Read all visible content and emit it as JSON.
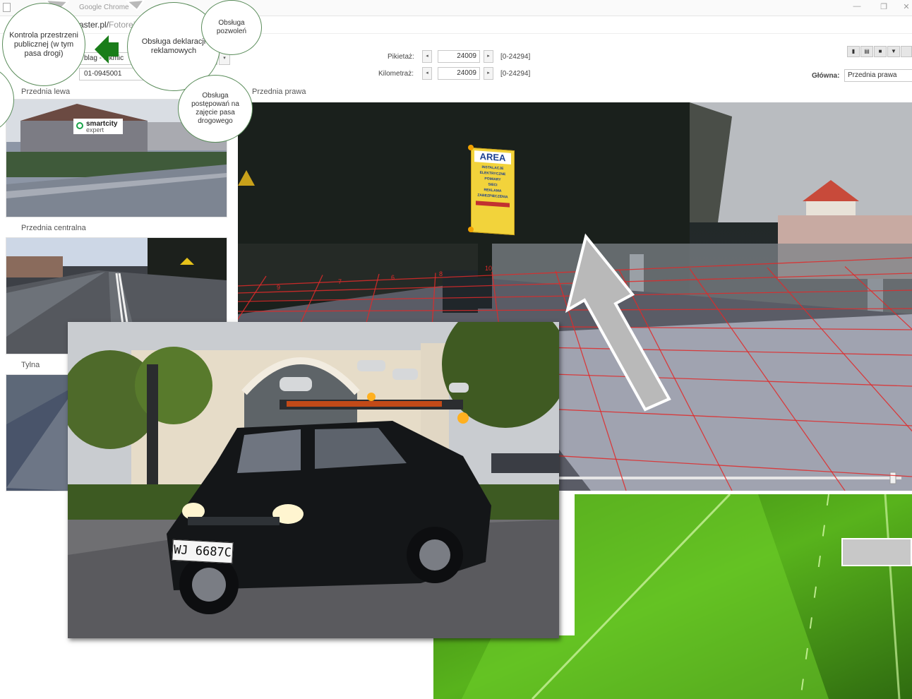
{
  "window": {
    "title": "Google Chrome",
    "url_host": "aster.pl/",
    "url_path": "Fotorej",
    "minimize_glyph": "—",
    "restore_glyph": "❐",
    "close_glyph": "✕"
  },
  "toolbar": {
    "drive_select": "blag - elkmic",
    "session_id": "01-0945001",
    "pikietaz_label": "Pikietaż:",
    "pikietaz_value": "24009",
    "pikietaz_range": "[0-24294]",
    "kilometraz_label": "Kilometraż:",
    "kilometraz_value": "24009",
    "kilometraz_range": "[0-24294]",
    "glowna_label": "Główna:",
    "glowna_value": "Przednia prawa",
    "prev_glyph": "◂",
    "next_glyph": "▸",
    "dropdown_glyph": "▾"
  },
  "panels": {
    "left_front": "Przednia lewa",
    "center_front": "Przednia centralna",
    "rear": "Tylna",
    "main_view": "Przednia prawa"
  },
  "watermark": {
    "brand_top": "smartcity",
    "brand_bottom": "expert"
  },
  "sign": {
    "heading": "AREA",
    "lines": [
      "INSTALACJE",
      "ELEKTRYCZNE",
      "POMIARY",
      "SIECI",
      "REKLAMA",
      "ZABEZPIECZENIA"
    ]
  },
  "grid_numbers": [
    "9",
    "7",
    "6",
    "8",
    "10"
  ],
  "plate": "WJ 6687C",
  "bubbles": [
    {
      "id": "kontrola",
      "text": "Kontrola przestrzeni publicznej (w tym pasa drogi)"
    },
    {
      "id": "deklaracje",
      "text": "Obsługa deklaracji reklamowych"
    },
    {
      "id": "pozwolenia",
      "text": "Obsługa pozwoleń"
    },
    {
      "id": "postepowania",
      "text": "Obsługa postępowań na zajęcie pasa drogowego"
    }
  ],
  "colors": {
    "accent_green": "#1a7d1a",
    "grid_red": "#e02a2a",
    "sign_yellow": "#f2d33b",
    "arrow_gray": "#b9b9b9"
  },
  "icons": [
    "camera-icon",
    "film-icon",
    "video-icon",
    "marker-icon"
  ]
}
